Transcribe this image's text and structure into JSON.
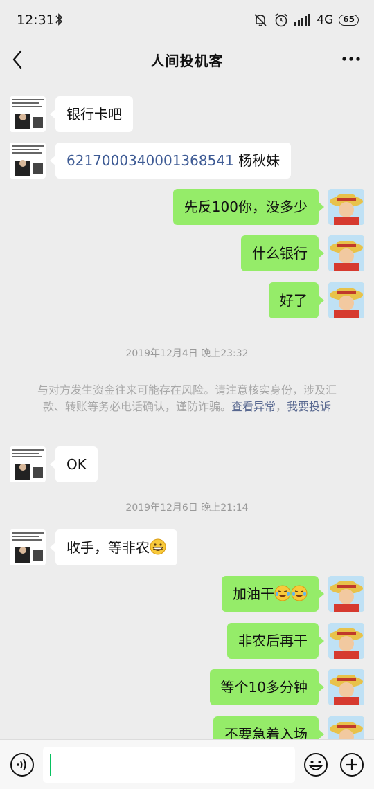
{
  "status_bar": {
    "time": "12:31",
    "network": "4G",
    "battery": "65"
  },
  "header": {
    "title": "人间投机客"
  },
  "messages": [
    {
      "side": "left",
      "text": "银行卡吧"
    },
    {
      "side": "left",
      "account": "6217000340001368541",
      "text": "杨秋妹"
    },
    {
      "side": "right",
      "text": "先反100你，没多少"
    },
    {
      "side": "right",
      "text": "什么银行"
    },
    {
      "side": "right",
      "text": "好了"
    },
    {
      "side": "left",
      "text": "OK"
    },
    {
      "side": "left",
      "text": "收手，等非农"
    },
    {
      "side": "right",
      "text": "加油干"
    },
    {
      "side": "right",
      "text": "非农后再干"
    },
    {
      "side": "right",
      "text": "等个10多分钟"
    },
    {
      "side": "right",
      "text": "不要急着入场"
    }
  ],
  "timestamps": [
    "2019年12月4日 晚上23:32",
    "2019年12月6日 晚上21:14"
  ],
  "notice": {
    "text": "与对方发生资金往来可能存在风险。请注意核实身份，涉及汇款、转账等务必电话确认，谨防诈骗。",
    "link1": "查看异常",
    "separator": "，",
    "link2": "我要投诉"
  },
  "icons": {
    "back": "back-arrow-icon",
    "more": "more-dots-icon",
    "voice": "voice-icon",
    "emoji": "emoji-icon",
    "plus": "plus-icon"
  },
  "colors": {
    "background": "#ededed",
    "sent_bubble": "#95ec69",
    "received_bubble": "#ffffff",
    "link": "#57678f"
  }
}
